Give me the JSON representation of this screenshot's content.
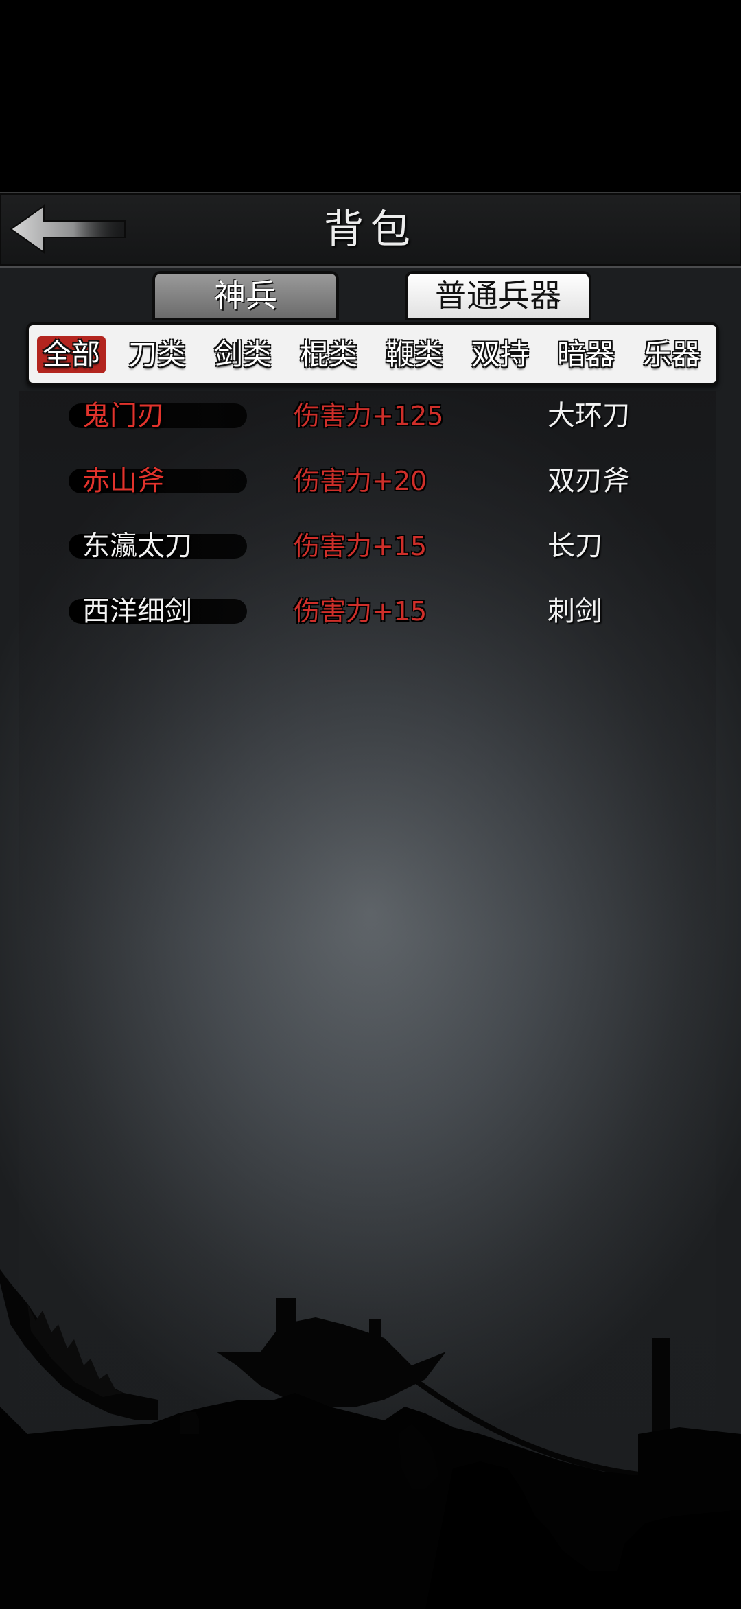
{
  "header": {
    "title": "背包",
    "back": "返回"
  },
  "tabs": [
    {
      "label": "神兵",
      "selected": false
    },
    {
      "label": "普通兵器",
      "selected": true
    }
  ],
  "filters": [
    {
      "label": "全部",
      "active": true
    },
    {
      "label": "刀类",
      "active": false
    },
    {
      "label": "剑类",
      "active": false
    },
    {
      "label": "棍类",
      "active": false
    },
    {
      "label": "鞭类",
      "active": false
    },
    {
      "label": "双持",
      "active": false
    },
    {
      "label": "暗器",
      "active": false
    },
    {
      "label": "乐器",
      "active": false
    }
  ],
  "items": [
    {
      "name": "鬼门刃",
      "name_color": "red",
      "damage": "伤害力+125",
      "type": "大环刀"
    },
    {
      "name": "赤山斧",
      "name_color": "red",
      "damage": "伤害力+20",
      "type": "双刃斧"
    },
    {
      "name": "东瀛太刀",
      "name_color": "white",
      "damage": "伤害力+15",
      "type": "长刀"
    },
    {
      "name": "西洋细剑",
      "name_color": "white",
      "damage": "伤害力+15",
      "type": "刺剑"
    }
  ],
  "colors": {
    "accent_red": "#b3251f",
    "damage_red": "#cf2f2a",
    "rare_name_red": "#e2332c"
  },
  "icons": {
    "back": "arrow-left-icon"
  }
}
